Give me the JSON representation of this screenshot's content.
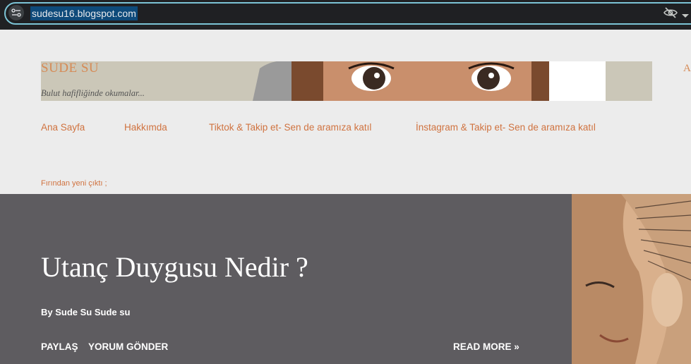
{
  "browser": {
    "url": "sudesu16.blogspot.com"
  },
  "header": {
    "title": "SUDE SU",
    "description": "Bulut hafifliğinde okumalar...",
    "right_stub": "A"
  },
  "nav": {
    "items": [
      {
        "label": "Ana Sayfa"
      },
      {
        "label": "Hakkımda"
      },
      {
        "label": "Tiktok & Takip et- Sen de aramıza katıl"
      },
      {
        "label": "İnstagram & Takip et- Sen de aramıza katıl"
      }
    ]
  },
  "section": {
    "label": "Fırından yeni çıktı ;"
  },
  "featured_post": {
    "title": "Utanç Duygusu Nedir ?",
    "byline": "By Sude Su Sude su",
    "share_label": "PAYLAŞ",
    "comment_label": "YORUM GÖNDER",
    "read_more_label": "READ MORE »"
  },
  "colors": {
    "accent": "#d07340",
    "featured_bg": "#5e5c60",
    "page_bg": "#ececec"
  }
}
